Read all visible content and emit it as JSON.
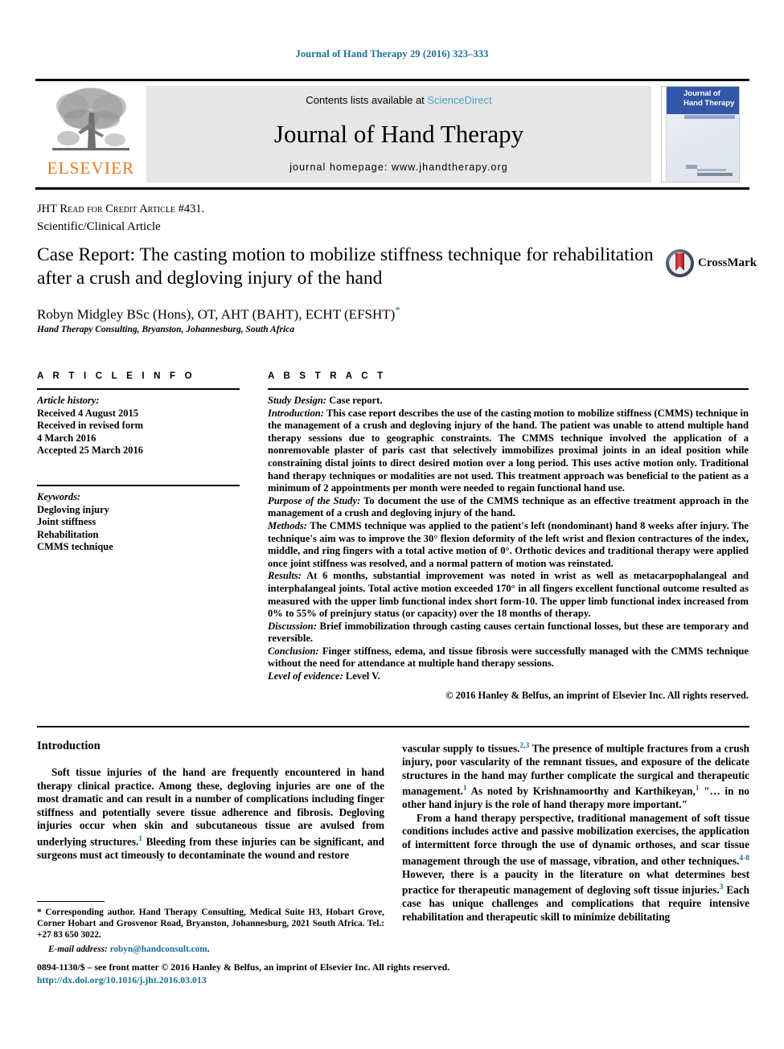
{
  "running_head": "Journal of Hand Therapy 29 (2016) 323–333",
  "masthead": {
    "publisher_logo_name": "ELSEVIER",
    "contents_prefix": "Contents lists available at ",
    "contents_link": "ScienceDirect",
    "journal_title": "Journal of Hand Therapy",
    "homepage": "journal homepage: www.jhandtherapy.org",
    "cover_title_line1": "Journal of",
    "cover_title_line2": "Hand Therapy"
  },
  "article_type": {
    "jht_credit": "JHT Read for Credit Article #431.",
    "category": "Scientific/Clinical Article"
  },
  "title": "Case Report: The casting motion to mobilize stiffness technique for rehabilitation after a crush and degloving injury of the hand",
  "crossmark_label": "CrossMark",
  "authors": "Robyn Midgley BSc (Hons), OT, AHT (BAHT), ECHT (EFSHT)",
  "affiliation": "Hand Therapy Consulting, Bryanston, Johannesburg, South Africa",
  "article_info": {
    "heading": "A R T I C L E   I N F O",
    "history_label": "Article history:",
    "history": [
      "Received 4 August 2015",
      "Received in revised form",
      "4 March 2016",
      "Accepted 25 March 2016"
    ],
    "keywords_label": "Keywords:",
    "keywords": [
      "Degloving injury",
      "Joint stiffness",
      "Rehabilitation",
      "CMMS technique"
    ]
  },
  "abstract": {
    "heading": "A B S T R A C T",
    "sections": [
      {
        "label": "Study Design:",
        "text": " Case report."
      },
      {
        "label": "Introduction:",
        "text": " This case report describes the use of the casting motion to mobilize stiffness (CMMS) technique in the management of a crush and degloving injury of the hand. The patient was unable to attend multiple hand therapy sessions due to geographic constraints. The CMMS technique involved the application of a nonremovable plaster of paris cast that selectively immobilizes proximal joints in an ideal position while constraining distal joints to direct desired motion over a long period. This uses active motion only. Traditional hand therapy techniques or modalities are not used. This treatment approach was beneficial to the patient as a minimum of 2 appointments per month were needed to regain functional hand use."
      },
      {
        "label": "Purpose of the Study:",
        "text": " To document the use of the CMMS technique as an effective treatment approach in the management of a crush and degloving injury of the hand."
      },
      {
        "label": "Methods:",
        "text": " The CMMS technique was applied to the patient's left (nondominant) hand 8 weeks after injury. The technique's aim was to improve the 30° flexion deformity of the left wrist and flexion contractures of the index, middle, and ring fingers with a total active motion of 0°. Orthotic devices and traditional therapy were applied once joint stiffness was resolved, and a normal pattern of motion was reinstated."
      },
      {
        "label": "Results:",
        "text": " At 6 months, substantial improvement was noted in wrist as well as metacarpophalangeal and interphalangeal joints. Total active motion exceeded 170° in all fingers excellent functional outcome resulted as measured with the upper limb functional index short form-10. The upper limb functional index increased from 0% to 55% of preinjury status (or capacity) over the 18 months of therapy."
      },
      {
        "label": "Discussion:",
        "text": " Brief immobilization through casting causes certain functional losses, but these are temporary and reversible."
      },
      {
        "label": "Conclusion:",
        "text": " Finger stiffness, edema, and tissue fibrosis were successfully managed with the CMMS technique without the need for attendance at multiple hand therapy sessions."
      },
      {
        "label": "Level of evidence:",
        "text": " Level V."
      }
    ],
    "copyright": "© 2016 Hanley & Belfus, an imprint of Elsevier Inc. All rights reserved."
  },
  "body": {
    "intro_heading": "Introduction",
    "left_paragraph_1_a": "Soft tissue injuries of the hand are frequently encountered in hand therapy clinical practice. Among these, degloving injuries are one of the most dramatic and can result in a number of complications including finger stiffness and potentially severe tissue adherence and fibrosis. Degloving injuries occur when skin and subcutaneous tissue are avulsed from underlying structures.",
    "left_paragraph_1_ref": "1",
    "left_paragraph_1_b": " Bleeding from these injuries can be significant, and surgeons must act timeously to decontaminate the wound and restore",
    "right_paragraph_1_a": "vascular supply to tissues.",
    "right_paragraph_1_ref1": "2,3",
    "right_paragraph_1_b": " The presence of multiple fractures from a crush injury, poor vascularity of the remnant tissues, and exposure of the delicate structures in the hand may further complicate the surgical and therapeutic management.",
    "right_paragraph_1_ref2": "1",
    "right_paragraph_1_c": " As noted by Krishnamoorthy and Karthikeyan,",
    "right_paragraph_1_ref3": "1",
    "right_paragraph_1_d": " \"… in no other hand injury is the role of hand therapy more important.\"",
    "right_paragraph_2_a": "From a hand therapy perspective, traditional management of soft tissue conditions includes active and passive mobilization exercises, the application of intermittent force through the use of dynamic orthoses, and scar tissue management through the use of massage, vibration, and other techniques.",
    "right_paragraph_2_ref1": "4-8",
    "right_paragraph_2_b": " However, there is a paucity in the literature on what determines best practice for therapeutic management of degloving soft tissue injuries.",
    "right_paragraph_2_ref2": "3",
    "right_paragraph_2_c": " Each case has unique challenges and complications that require intensive rehabilitation and therapeutic skill to minimize debilitating"
  },
  "footnote": {
    "corresponding": "* Corresponding author. Hand Therapy Consulting, Medical Suite H3, Hobart Grove, Corner Hobart and Grosvenor Road, Bryanston, Johannesburg, 2021 South Africa. Tel.: +27 83 650 3022.",
    "email_label": "E-mail address:",
    "email": "robyn@handconsult.com"
  },
  "page_footer": {
    "issn_line": "0894-1130/$ – see front matter © 2016 Hanley & Belfus, an imprint of Elsevier Inc. All rights reserved.",
    "doi": "http://dx.doi.org/10.1016/j.jht.2016.03.013"
  },
  "colors": {
    "link": "#1a6e96",
    "sciencedirect": "#4ea3cd",
    "elsevier_orange": "#E87722",
    "cover_blue": "#3257a8"
  }
}
